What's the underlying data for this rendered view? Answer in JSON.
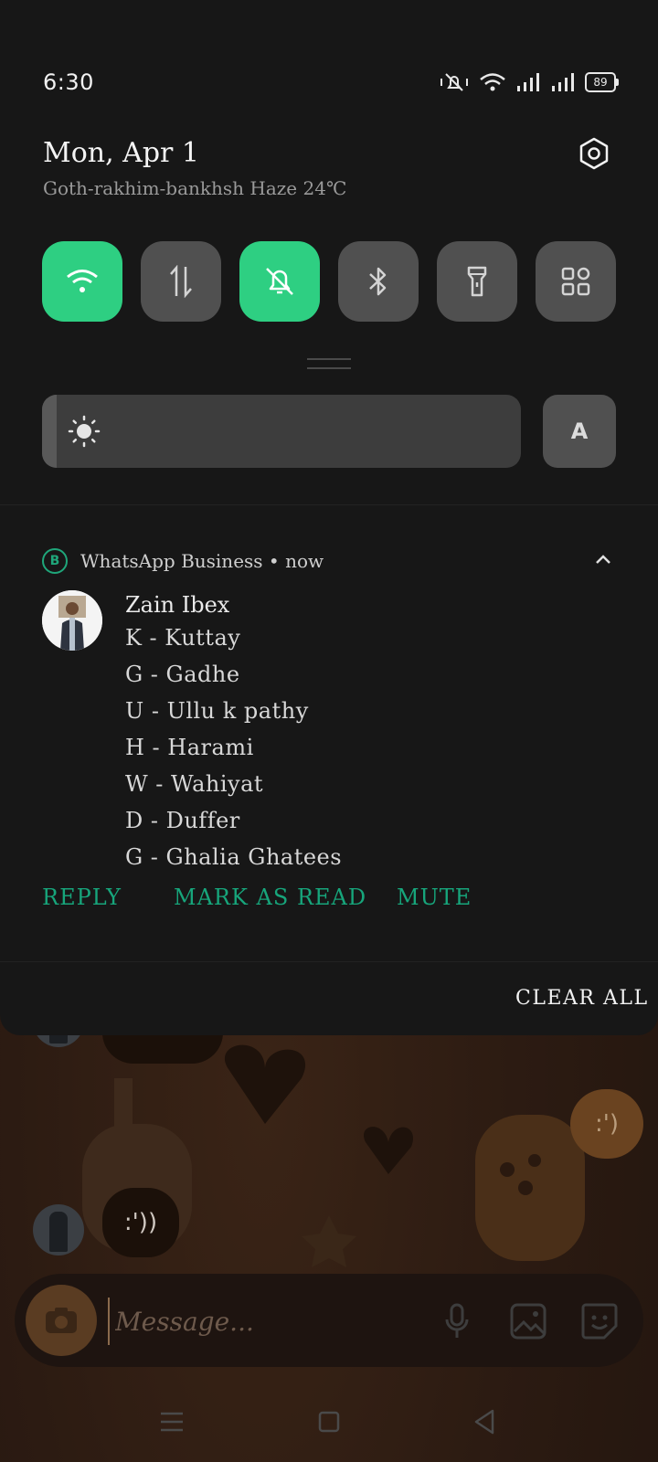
{
  "status_bar": {
    "time": "6:30",
    "battery": "89"
  },
  "panel": {
    "date": "Mon, Apr 1",
    "weather": "Goth-rakhim-bankhsh Haze 24℃",
    "auto_brightness_label": "A",
    "brightness_level": 0.03,
    "tiles": [
      {
        "icon": "wifi-icon",
        "active": true
      },
      {
        "icon": "mobile-data-icon",
        "active": false
      },
      {
        "icon": "silent-bell-icon",
        "active": true
      },
      {
        "icon": "bluetooth-icon",
        "active": false
      },
      {
        "icon": "flashlight-icon",
        "active": false
      },
      {
        "icon": "more-tiles-icon",
        "active": false
      }
    ]
  },
  "notification": {
    "app_badge": "B",
    "app_line": "WhatsApp Business • now",
    "sender": "Zain Ibex",
    "lines": [
      "K - Kuttay",
      "G - Gadhe",
      "U - Ullu k pathy",
      "H - Harami",
      "W - Wahiyat",
      "D - Duffer",
      "G - Ghalia Ghatees"
    ],
    "actions": {
      "reply": "REPLY",
      "mark_read": "MARK AS READ",
      "mute": "MUTE"
    }
  },
  "clear_all": "CLEAR ALL",
  "chat": {
    "bubble_1": ":'))",
    "bubble_right": ":')",
    "message_placeholder": "Message..."
  },
  "colors": {
    "accent_green": "#2ecf82",
    "action_green": "#17a57b",
    "panel_bg": "#171717"
  }
}
